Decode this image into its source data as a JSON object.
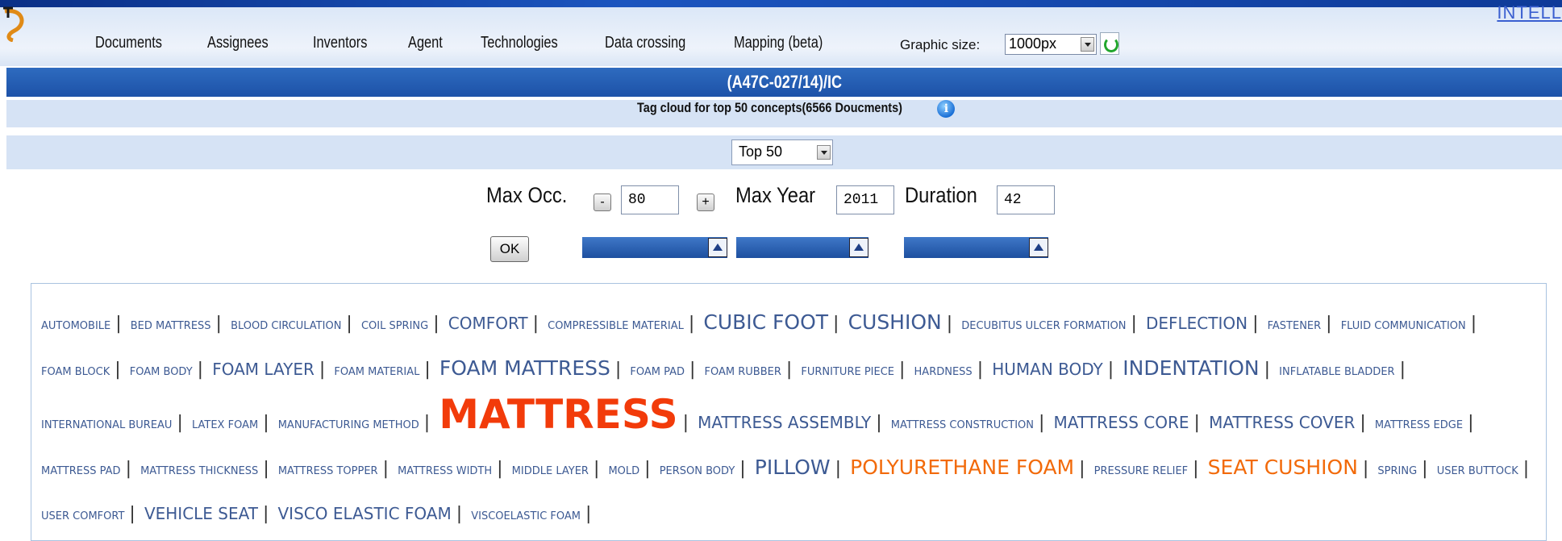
{
  "header": {
    "brand_text": "INTELL",
    "nav": [
      "Documents",
      "Assignees",
      "Inventors",
      "Agent",
      "Technologies",
      "Data crossing",
      "Mapping (beta)"
    ],
    "graphic_size_label": "Graphic size:",
    "graphic_size_value": "1000px"
  },
  "title": "(A47C-027/14)/IC",
  "subtitle": "Tag cloud for top 50 concepts(6566 Doucments)",
  "top_select": "Top 50",
  "controls": {
    "max_occ_label": "Max Occ.",
    "minus": "-",
    "plus": "+",
    "max_occ_value": "80",
    "max_year_label": "Max Year",
    "max_year_value": "2011",
    "duration_label": "Duration",
    "duration_value": "42",
    "ok": "OK"
  },
  "tags": [
    {
      "t": "AUTOMOBILE",
      "s": "s1"
    },
    {
      "t": "BED MATTRESS",
      "s": "s1"
    },
    {
      "t": "BLOOD CIRCULATION",
      "s": "s1"
    },
    {
      "t": "COIL SPRING",
      "s": "s1"
    },
    {
      "t": "COMFORT",
      "s": "s2"
    },
    {
      "t": "COMPRESSIBLE MATERIAL",
      "s": "s1"
    },
    {
      "t": "CUBIC FOOT",
      "s": "s3"
    },
    {
      "t": "CUSHION",
      "s": "s3"
    },
    {
      "t": "DECUBITUS ULCER FORMATION",
      "s": "s1"
    },
    {
      "t": "DEFLECTION",
      "s": "s2"
    },
    {
      "t": "FASTENER",
      "s": "s1"
    },
    {
      "t": "FLUID COMMUNICATION",
      "s": "s1"
    },
    {
      "t": "FOAM BLOCK",
      "s": "s1"
    },
    {
      "t": "FOAM BODY",
      "s": "s1"
    },
    {
      "t": "FOAM LAYER",
      "s": "s2"
    },
    {
      "t": "FOAM MATERIAL",
      "s": "s1"
    },
    {
      "t": "FOAM MATTRESS",
      "s": "s3"
    },
    {
      "t": "FOAM PAD",
      "s": "s1"
    },
    {
      "t": "FOAM RUBBER",
      "s": "s1"
    },
    {
      "t": "FURNITURE PIECE",
      "s": "s1"
    },
    {
      "t": "HARDNESS",
      "s": "s1"
    },
    {
      "t": "HUMAN BODY",
      "s": "s2"
    },
    {
      "t": "INDENTATION",
      "s": "s3"
    },
    {
      "t": "INFLATABLE BLADDER",
      "s": "s1"
    },
    {
      "t": "INTERNATIONAL BUREAU",
      "s": "s1"
    },
    {
      "t": "LATEX FOAM",
      "s": "s1"
    },
    {
      "t": "MANUFACTURING METHOD",
      "s": "s1"
    },
    {
      "t": "MATTRESS",
      "s": "big"
    },
    {
      "t": "MATTRESS ASSEMBLY",
      "s": "s2"
    },
    {
      "t": "MATTRESS CONSTRUCTION",
      "s": "s1"
    },
    {
      "t": "MATTRESS CORE",
      "s": "s2"
    },
    {
      "t": "MATTRESS COVER",
      "s": "s2"
    },
    {
      "t": "MATTRESS EDGE",
      "s": "s1"
    },
    {
      "t": "MATTRESS PAD",
      "s": "s1"
    },
    {
      "t": "MATTRESS THICKNESS",
      "s": "s1"
    },
    {
      "t": "MATTRESS TOPPER",
      "s": "s1"
    },
    {
      "t": "MATTRESS WIDTH",
      "s": "s1"
    },
    {
      "t": "MIDDLE LAYER",
      "s": "s1"
    },
    {
      "t": "MOLD",
      "s": "s1"
    },
    {
      "t": "PERSON BODY",
      "s": "s1"
    },
    {
      "t": "PILLOW",
      "s": "s3"
    },
    {
      "t": "POLYURETHANE FOAM",
      "s": "orange"
    },
    {
      "t": "PRESSURE RELIEF",
      "s": "s1"
    },
    {
      "t": "SEAT CUSHION",
      "s": "orange"
    },
    {
      "t": "SPRING",
      "s": "s1"
    },
    {
      "t": "USER BUTTOCK",
      "s": "s1"
    },
    {
      "t": "USER COMFORT",
      "s": "s1"
    },
    {
      "t": "VEHICLE SEAT",
      "s": "s2"
    },
    {
      "t": "VISCO ELASTIC FOAM",
      "s": "s2"
    },
    {
      "t": "VISCOELASTIC FOAM",
      "s": "s1"
    }
  ]
}
